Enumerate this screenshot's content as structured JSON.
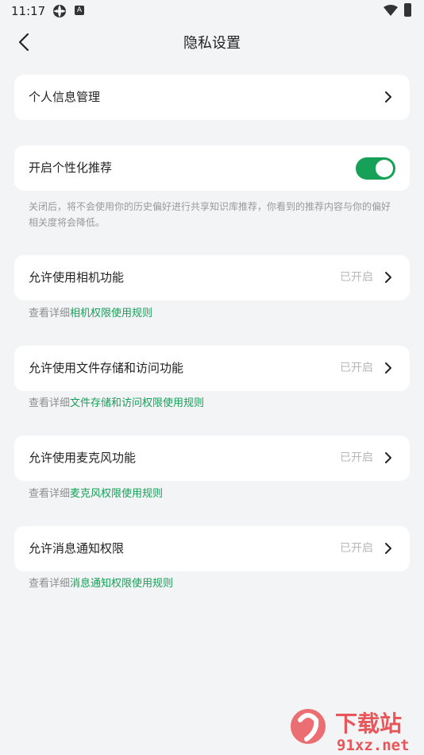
{
  "status_bar": {
    "time": "11:17",
    "icons": [
      "settings-app-icon",
      "a-badge-icon",
      "wifi-icon",
      "battery-icon"
    ]
  },
  "header": {
    "back_icon": "chevron-left-icon",
    "title": "隐私设置"
  },
  "items": {
    "personal_info": {
      "label": "个人信息管理"
    },
    "personalized": {
      "label": "开启个性化推荐",
      "toggle_on": true,
      "description": "关闭后，将不会使用你的历史偏好进行共享知识库推荐，你看到的推荐内容与你的偏好相关度将会降低。"
    },
    "camera": {
      "label": "允许使用相机功能",
      "status": "已开启",
      "hint_prefix": "查看详细",
      "hint_link": "相机权限使用规则"
    },
    "storage": {
      "label": "允许使用文件存储和访问功能",
      "status": "已开启",
      "hint_prefix": "查看详细",
      "hint_link": "文件存储和访问权限使用规则"
    },
    "microphone": {
      "label": "允许使用麦克风功能",
      "status": "已开启",
      "hint_prefix": "查看详细",
      "hint_link": "麦克风权限使用规则"
    },
    "notification": {
      "label": "允许消息通知权限",
      "status": "已开启",
      "hint_prefix": "查看详细",
      "hint_link": "消息通知权限使用规则"
    }
  },
  "watermark": {
    "brand": "下载站",
    "domain": "91xz.net"
  },
  "colors": {
    "accent": "#16a058",
    "background": "#f3f4f6",
    "card": "#ffffff",
    "muted_text": "#9a9a9a"
  }
}
